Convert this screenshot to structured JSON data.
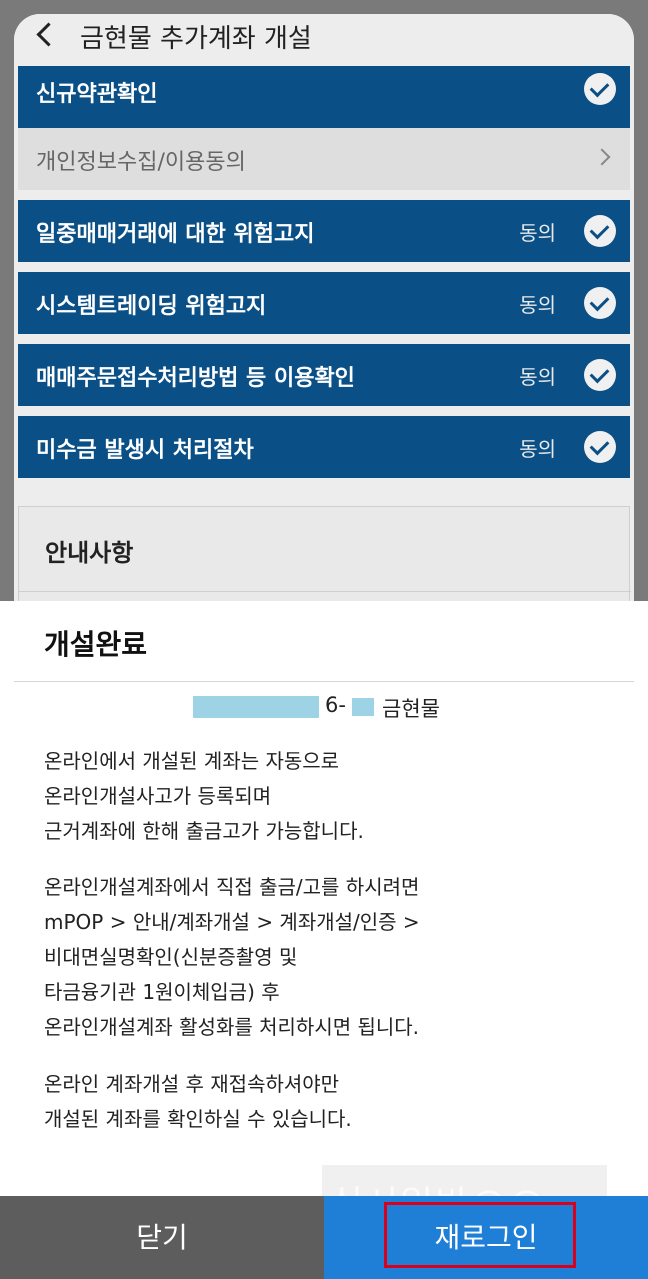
{
  "header": {
    "title": "금현물 추가계좌 개설"
  },
  "rows": [
    {
      "label": "신규약관확인",
      "agree": ""
    },
    {
      "label": "개인정보수집/이용동의",
      "agree": ""
    },
    {
      "label": "일중매매거래에 대한 위험고지",
      "agree": "동의"
    },
    {
      "label": "시스템트레이딩 위험고지",
      "agree": "동의"
    },
    {
      "label": "매매주문접수처리방법 등 이용확인",
      "agree": "동의"
    },
    {
      "label": "미수금 발생시 처리절차",
      "agree": "동의"
    }
  ],
  "notice": {
    "title": "안내사항"
  },
  "modal": {
    "title": "개설완료",
    "account": {
      "mid": "6-",
      "name": "금현물"
    },
    "paragraphs": [
      [
        "온라인에서 개설된 계좌는 자동으로",
        "온라인개설사고가 등록되며",
        "근거계좌에 한해 출금고가 가능합니다."
      ],
      [
        "온라인개설계좌에서 직접 출금/고를 하시려면",
        "mPOP > 안내/계좌개설 > 계좌개설/인증 >",
        "비대면실명확인(신분증촬영 및",
        "타금융기관 1원이체입금) 후",
        "온라인개설계좌 활성화를 처리하시면 됩니다."
      ],
      [
        "온라인 계좌개설 후 재접속하셔야만",
        "개설된 계좌를 확인하실 수 있습니다."
      ]
    ]
  },
  "footer": {
    "close_label": "닫기",
    "relogin_label": "재로그인"
  },
  "watermark": {
    "text": "십시일반@@"
  },
  "colors": {
    "row_blue": "#0a4f86",
    "button_blue": "#1f7fd6",
    "highlight_red": "#d9001b"
  }
}
